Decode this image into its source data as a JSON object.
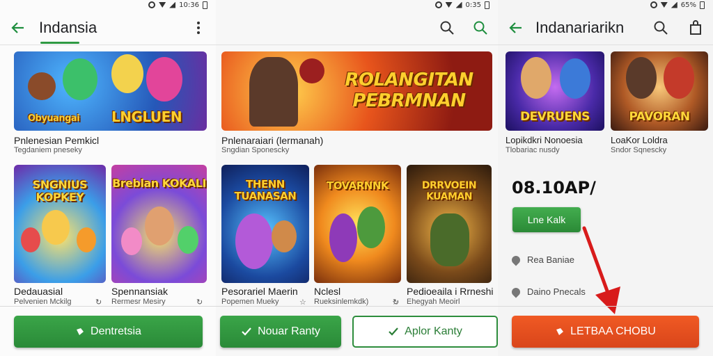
{
  "panel1": {
    "status": "10:36",
    "title": "Indansia",
    "featured": {
      "banner": "LNGLUEN",
      "sub_banner": "Obyuangai",
      "caption": "Pnlenesian Pemkicl",
      "subcaption": "Tegdaniem pneseky"
    },
    "cards": [
      {
        "banner": "SNGNIUS KOPKEY",
        "caption": "Dedauasial",
        "subcaption": "Pelvenien Mckilg"
      },
      {
        "banner": "Breblan KOKALI",
        "caption": "Spennansiak",
        "subcaption": "Rermesr Mesiry"
      }
    ],
    "button": "Dentretsia"
  },
  "panel2": {
    "status": "0:35",
    "featured": {
      "banner": "ROLANGITAN PEBRMNAN",
      "caption": "Pnlenaraiari (lermanah)",
      "subcaption": "Sngdian Sponescky"
    },
    "cards": [
      {
        "banner": "THENN TUANASAN",
        "caption": "Pesorariel Maerin",
        "subcaption": "Popemen Mueky"
      },
      {
        "banner": "TOVARNNK",
        "caption": "Nclesl",
        "subcaption": "Rueksinlemkdk)"
      },
      {
        "banner": "DRRVOEIN KUAMAN",
        "caption": "Pedioeaila i Rrneshi",
        "subcaption": "Ehegyah Meoirl"
      }
    ],
    "button_primary": "Nouar Ranty",
    "button_secondary": "Aplor Kanty"
  },
  "panel3": {
    "status": "65%",
    "title": "Indanariarikn",
    "cards": [
      {
        "banner": "DEVRUENS",
        "caption": "Lopikdkri Nonoesia",
        "subcaption": "Tlobariac nusdy"
      },
      {
        "banner": "PAVORAN",
        "caption": "LoaKor Loldra",
        "subcaption": "Sndor Sqnescky"
      }
    ],
    "time": "08.10AP/",
    "line_button": "Lne Kalk",
    "info": [
      "Rea Baniae",
      "Daino Pnecals"
    ],
    "button": "LETBAA CHOBU"
  },
  "colors": {
    "green": "#2e9a43",
    "orange": "#e8501f",
    "red_arrow": "#d81b1b"
  },
  "icons": [
    "back-arrow-icon",
    "more-vert-icon",
    "search-icon",
    "shopping-bag-icon",
    "check-icon",
    "ticket-icon",
    "location-icon"
  ]
}
